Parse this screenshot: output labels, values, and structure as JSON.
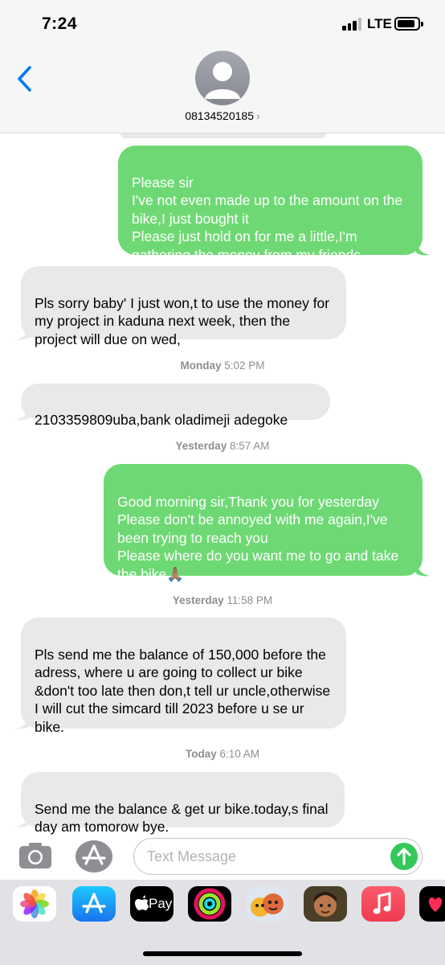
{
  "status_bar": {
    "time": "7:24",
    "network": "LTE"
  },
  "header": {
    "contact_name": "08134520185",
    "chevron": "›"
  },
  "messages": [
    {
      "direction": "out",
      "text": " Please sir\nI've not even made up to the amount on the bike,I just bought it\nPlease just hold on for me a little,I'm gathering the money from my friends"
    },
    {
      "direction": "in",
      "text": "Pls sorry baby' I just won,t to use the money for my project in kaduna next week, then the project will due on wed,"
    },
    {
      "direction": "in",
      "text": "2103359809uba,bank oladimeji adegoke"
    },
    {
      "direction": "out",
      "text": "Good morning sir,Thank you for yesterday\nPlease don't be annoyed with me again,I've been trying to reach you\nPlease where do you want me to go and take the bike🙏🏽"
    },
    {
      "direction": "in",
      "text": "Pls send me the balance of 150,000 before the adress, where u are going to collect ur bike &don't too late then don,t tell ur uncle,otherwise I will cut the simcard till 2023 before u se ur bike."
    },
    {
      "direction": "in",
      "text": "Send me the balance & get ur bike.today,s final day am tomorow bye."
    }
  ],
  "timestamps": [
    {
      "day": "Monday",
      "time": "5:02 PM"
    },
    {
      "day": "Yesterday",
      "time": "8:57 AM"
    },
    {
      "day": "Yesterday",
      "time": "11:58 PM"
    },
    {
      "day": "Today",
      "time": "6:10 AM"
    }
  ],
  "input": {
    "placeholder": "Text Message"
  },
  "apps": [
    "photos-icon",
    "app-store-icon",
    "apple-pay-icon",
    "activity-icon",
    "animoji-icon",
    "memoji-icon",
    "music-icon",
    "digital-touch-icon"
  ],
  "app_labels": {
    "apple_pay": "Pay"
  },
  "colors": {
    "outgoing": "#6ed974",
    "incoming": "#e9e9eb",
    "accent": "#007aff",
    "send": "#34c759"
  }
}
